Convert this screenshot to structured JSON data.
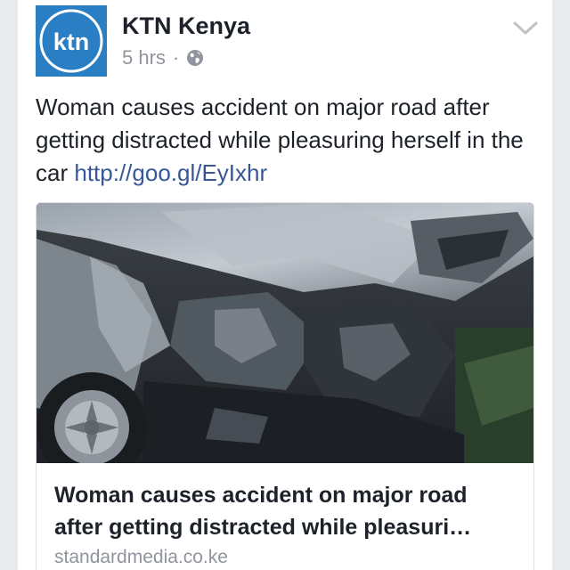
{
  "post": {
    "page_name": "KTN Kenya",
    "avatar_text": "ktn",
    "timestamp": "5 hrs",
    "separator": "·",
    "privacy_icon": "globe-icon",
    "menu_icon": "chevron-down-icon",
    "text": "Woman causes accident on major road after getting distracted while pleasuring herself in the car",
    "link": "http://goo.gl/EyIxhr"
  },
  "link_preview": {
    "image_description_icon": "crashed-car-photo",
    "title_line1": "Woman causes accident on major road",
    "title_line2": "after getting distracted while pleasuri…",
    "domain": "standardmedia.co.ke"
  },
  "colors": {
    "brand_blue": "#2a7fc4",
    "link_blue": "#365899",
    "text_dark": "#1d2129",
    "text_muted": "#90949c",
    "background": "#e9ebee"
  }
}
